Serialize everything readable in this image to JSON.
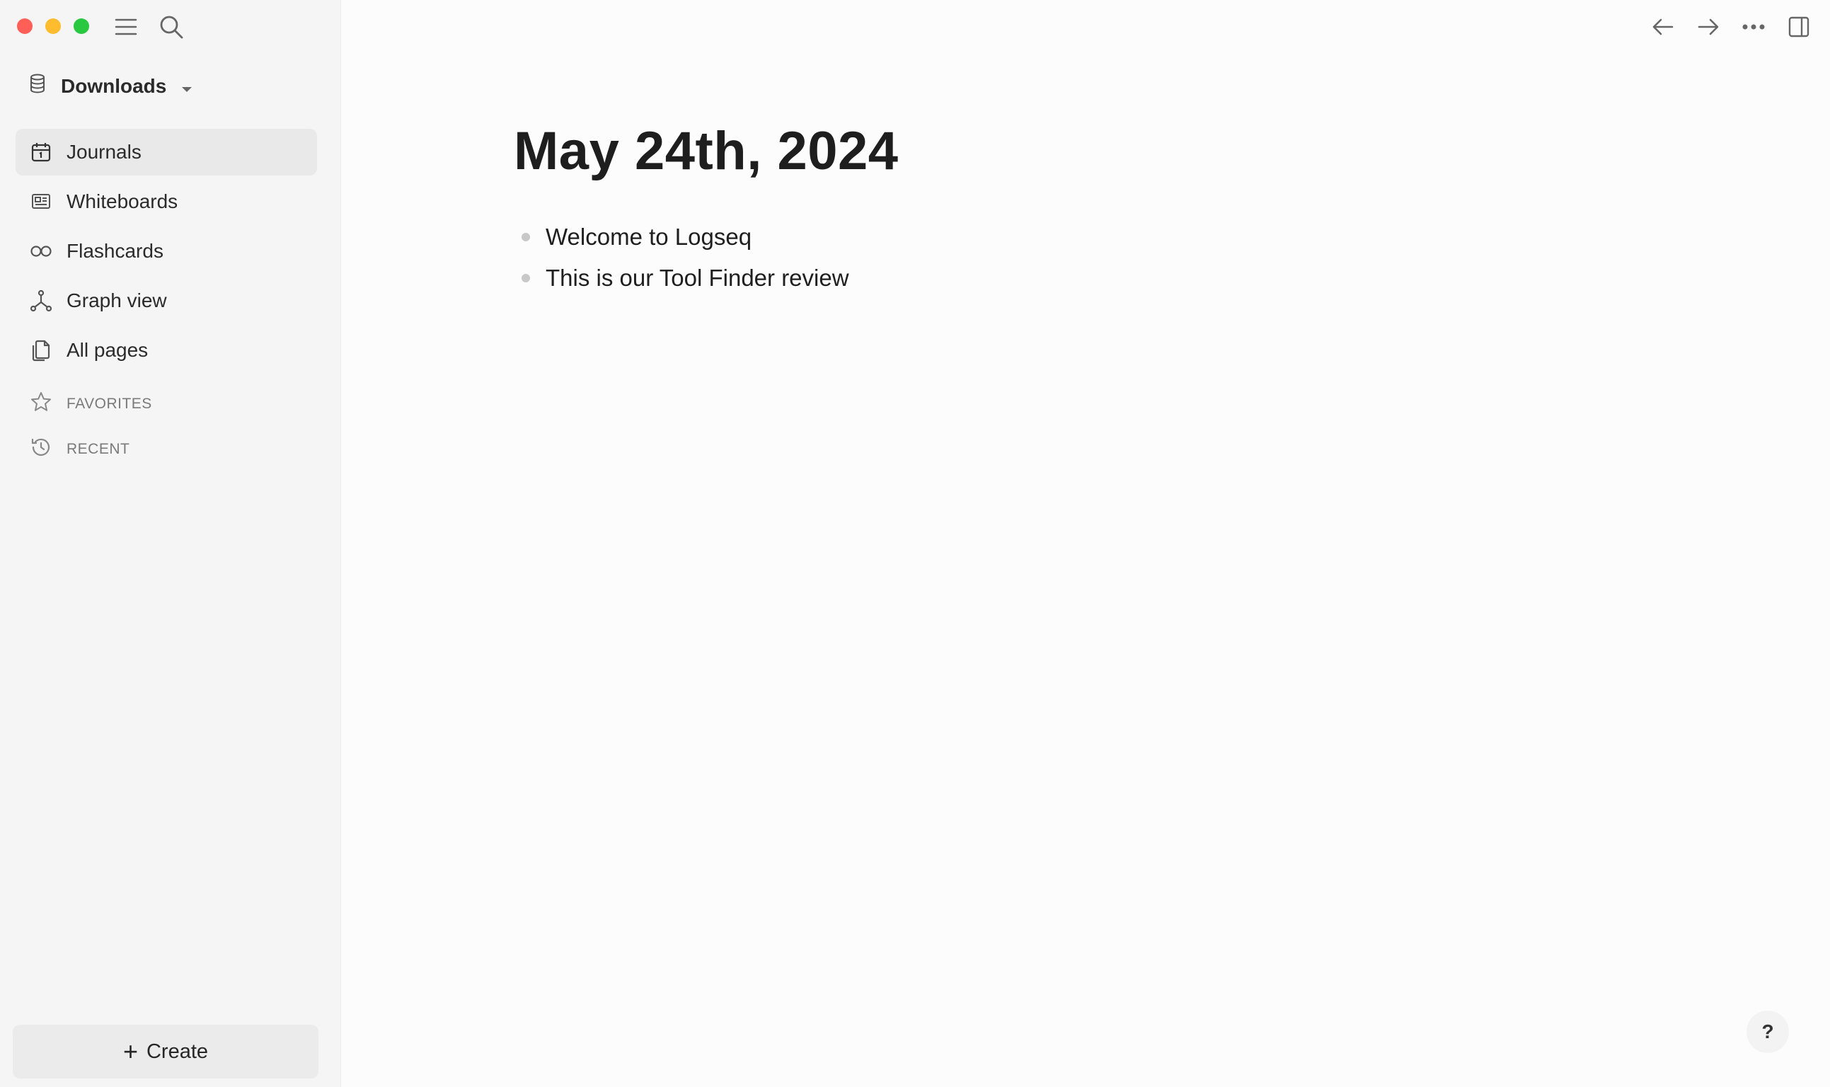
{
  "window": {
    "traffic_lights": {
      "close": "#ff5f57",
      "minimize": "#febc2e",
      "maximize": "#28c840"
    }
  },
  "toolbar": {
    "left_icons": [
      "menu-icon",
      "search-icon"
    ],
    "right_icons": [
      "arrow-left-icon",
      "arrow-right-icon",
      "more-icon",
      "right-sidebar-icon"
    ]
  },
  "sidebar": {
    "graph_name": "Downloads",
    "items": [
      {
        "label": "Journals",
        "icon": "calendar-icon",
        "active": true
      },
      {
        "label": "Whiteboards",
        "icon": "whiteboard-icon",
        "active": false
      },
      {
        "label": "Flashcards",
        "icon": "infinity-icon",
        "active": false
      },
      {
        "label": "Graph view",
        "icon": "graph-icon",
        "active": false
      },
      {
        "label": "All pages",
        "icon": "pages-icon",
        "active": false
      }
    ],
    "favorites_label": "FAVORITES",
    "recent_label": "RECENT",
    "create_label": "Create"
  },
  "page": {
    "title": "May 24th, 2024",
    "blocks": [
      "Welcome to Logseq",
      "This is our Tool Finder review"
    ]
  },
  "help": {
    "label": "?"
  }
}
